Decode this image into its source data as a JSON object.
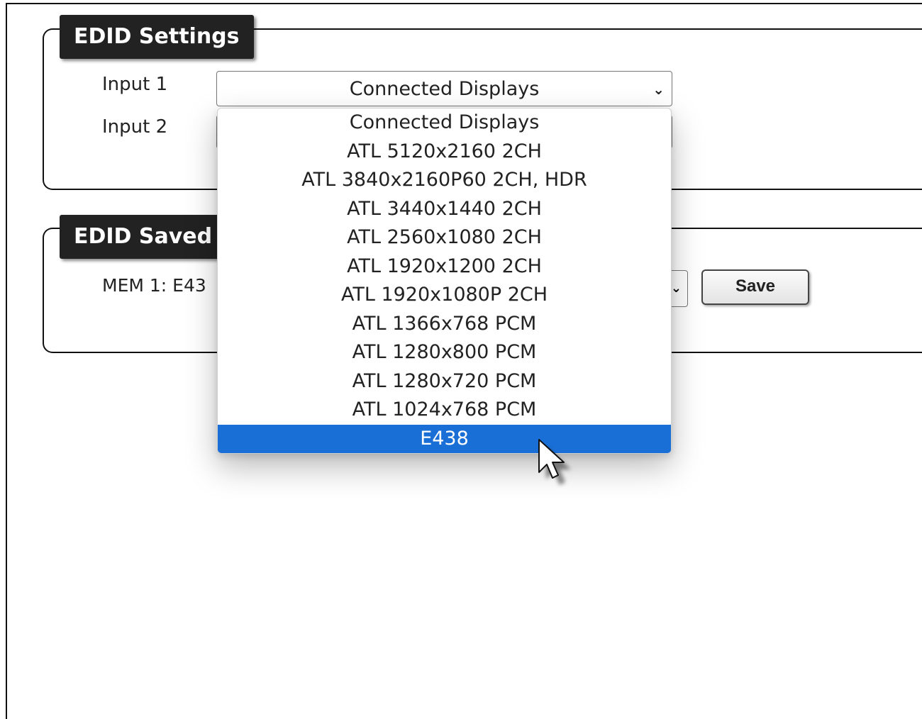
{
  "edid_settings": {
    "title": "EDID Settings",
    "inputs": [
      {
        "label": "Input 1",
        "selected": "Connected Displays"
      },
      {
        "label": "Input 2",
        "selected": ""
      }
    ]
  },
  "dropdown": {
    "options": [
      "Connected Displays",
      "ATL 5120x2160 2CH",
      "ATL 3840x2160P60 2CH, HDR",
      "ATL 3440x1440 2CH",
      "ATL 2560x1080 2CH",
      "ATL 1920x1200 2CH",
      "ATL 1920x1080P 2CH",
      "ATL 1366x768 PCM",
      "ATL 1280x800 PCM",
      "ATL 1280x720 PCM",
      "ATL 1024x768 PCM",
      "E438"
    ],
    "highlighted_index": 11
  },
  "edid_saved": {
    "title": "EDID Saved",
    "mem1_label": "MEM 1:  E43",
    "save_label": "Save"
  },
  "colors": {
    "legend_bg": "#222222",
    "highlight": "#1a6fd6"
  }
}
